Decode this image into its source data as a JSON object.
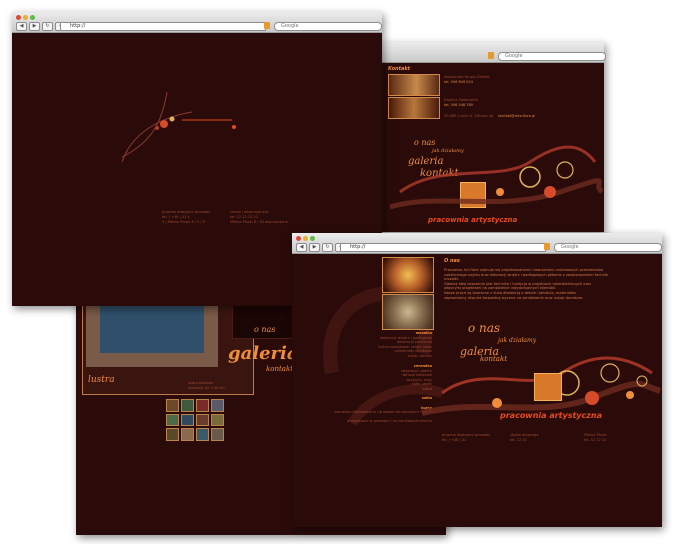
{
  "browser": {
    "url": "http://",
    "search_placeholder": "Google"
  },
  "colors": {
    "background": "#2a0b0a",
    "accent": "#f08d3a",
    "chrome": "#d4d4d4"
  },
  "win1": {
    "footer_left": [
      "prawnie dostępny sprzedaż",
      "tel. | +48 | 41 4",
      "5 | Mielno Pluski 8 / 5 / 5"
    ],
    "footer_right": [
      "studio | ekspresja ona",
      "tel. 12.12.12.12",
      "Mielno Pluski 8 / 54 dopuszczone"
    ]
  },
  "win2": {
    "heading": "Kontakt",
    "person1": {
      "name": "Aleksandra Krupa-Zientek",
      "tel": "tel. 506 649 024"
    },
    "person2": {
      "name": "Ewelina Sałamacha",
      "tel": "tel. 506 548 780"
    },
    "address": "20-580 Lublin ul. Zdrowa 4b",
    "email": "kontakt@arte-fiore.pl",
    "menu": [
      "o nas",
      "jak działamy",
      "galeria",
      "kontakt"
    ],
    "logo_text": "pracownia artystyczna"
  },
  "win3": {
    "menu": [
      "o nas",
      "galeria",
      "kontakt"
    ],
    "caption": "lustra",
    "price_lines": [
      "lustro kalkowe",
      "wymiary: 40 x 40 cm"
    ],
    "logo_text": "pracownia"
  },
  "win4": {
    "heading": "O nas",
    "intro": [
      "Pracownia Art-Fiore zajmuje się projektowaniem i tworzeniem unikatowych przedmiotów",
      "codziennego użytku oraz dekoracji wnętrz i podłogowych głównie z zastosowaniem technik",
      "mozaiki.",
      "Główną ideą tworzenia jest technika i tradycja w projektach rękodzielniczych oraz",
      "własnymi projektami na zamówienie indywidualnych klientów.",
      "Nasze prace są tworzone z dużą dbałością o detale i jakością, materiałów",
      "zapewniamy również bezpłatną wycenę na zamówienie oraz usługi doradcze."
    ],
    "sections": [
      {
        "title": "mozaika",
        "items": [
          "dekoracje wnętrz i podłogowe",
          "dekoracje kuchenne",
          "lustra mozaikowe, ramki, blaty",
          "przedmioty użytkowe",
          "stoliki, obrazy"
        ]
      },
      {
        "title": "ceramika",
        "items": [
          "dekoracje, patery",
          "witraże kolorowe",
          "naczynia, misy",
          "kafle, płytki",
          "lustra"
        ]
      },
      {
        "title": "szkło",
        "items": []
      },
      {
        "title": "kursy",
        "items": [
          "warsztaty indywidualne i grupowe dla dorosłych i dzieci",
          "prowadzone w pracowni i na zamówienie klienta"
        ]
      }
    ],
    "menu": [
      "o nas",
      "jak działamy",
      "galeria",
      "kontakt"
    ],
    "logo_text": "pracownia artystyczna",
    "footer_left": [
      "prawnie dostępny sprzedaż",
      "tel. | +48 | 41"
    ],
    "footer_mid": [
      "studio ekspresja",
      "tel. 12.12"
    ],
    "footer_right": [
      "Mielno Pluski",
      "tel. 12 12 12"
    ]
  }
}
